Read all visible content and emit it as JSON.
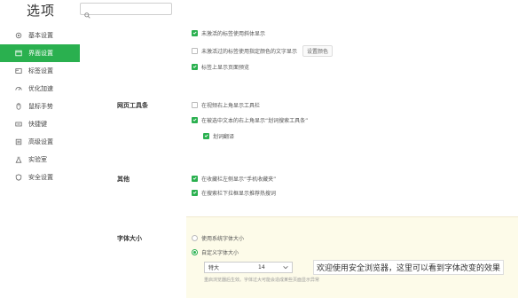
{
  "window": {
    "title": "选项"
  },
  "search": {
    "placeholder": "",
    "value": ""
  },
  "sidebar": {
    "items": [
      {
        "label": "基本设置",
        "icon": "gear-icon",
        "active": false
      },
      {
        "label": "界面设置",
        "icon": "window-icon",
        "active": true
      },
      {
        "label": "标签设置",
        "icon": "tab-icon",
        "active": false
      },
      {
        "label": "优化加速",
        "icon": "speed-icon",
        "active": false
      },
      {
        "label": "鼠标手势",
        "icon": "mouse-icon",
        "active": false
      },
      {
        "label": "快捷键",
        "icon": "keyboard-icon",
        "active": false
      },
      {
        "label": "高级设置",
        "icon": "advanced-icon",
        "active": false
      },
      {
        "label": "实验室",
        "icon": "lab-icon",
        "active": false
      },
      {
        "label": "安全设置",
        "icon": "shield-icon",
        "active": false
      }
    ]
  },
  "tabs_section": {
    "opt1": "未激活的标签使用斜体显示",
    "opt2": "未激活过的标签使用指定颜色的文字显示",
    "opt2_button": "设置颜色",
    "opt3": "标签上显示页面预览"
  },
  "toolbar_section": {
    "label": "网页工具条",
    "opt1": "在视频右上角显示工具栏",
    "opt2": "在被选中文本的右上角显示“划词搜索工具条”",
    "opt2_sub": "划词翻译"
  },
  "other_section": {
    "label": "其他",
    "opt1": "在收藏栏左侧显示“手机收藏夹”",
    "opt2": "在搜索栏下拉框显示推荐热搜词"
  },
  "font_section": {
    "label": "字体大小",
    "radio1": "使用系统字体大小",
    "radio2": "自定义字体大小",
    "size_select": "特大",
    "size_value": "14",
    "preview_text": "欢迎使用安全浏览器，这里可以看到字体改变的效果",
    "hint": "重启浏览器后生效。字体过大可能会造成某些页面显示异常"
  },
  "colors": {
    "accent": "#2ab04f",
    "panel_bg": "#fdfbe9"
  }
}
